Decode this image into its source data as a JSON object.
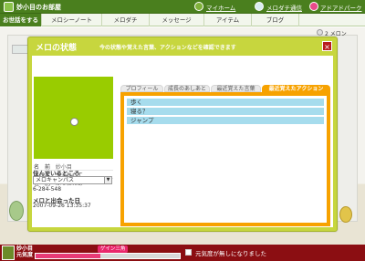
{
  "header": {
    "room_title": "妙小目のお部屋",
    "links": [
      {
        "label": "マイホーム"
      },
      {
        "label": "メロダチ通信"
      },
      {
        "label": "アドアドパーク"
      }
    ]
  },
  "nav": {
    "items": [
      {
        "label": "お世話をする"
      },
      {
        "label": "メロシーノート"
      },
      {
        "label": "メロダチ"
      },
      {
        "label": "メッセージ"
      },
      {
        "label": "アイテム"
      },
      {
        "label": "ブログ"
      }
    ]
  },
  "scene": {
    "meron_count": "2 メロン"
  },
  "modal": {
    "title": "メロの状態",
    "subtitle": "今の状態や覚えた言葉、アクションなどを確認できます",
    "close": "×",
    "profile": {
      "name_key": "名　前",
      "name_val": "妙小目",
      "age_key": "メロ年",
      "age_val": "生まれたて",
      "sex_key": "性　別",
      "sex_val": "ふつにえあ"
    },
    "residence": {
      "title": "住んでいるところ",
      "selected": "メロキャンパス",
      "code": "6-284-548"
    },
    "met": {
      "title": "メロと出会った日",
      "date": "2007-09-26 13:35:37"
    },
    "tabs": [
      {
        "label": "プロフィール"
      },
      {
        "label": "成長のあしあと"
      },
      {
        "label": "最近覚えた言葉"
      },
      {
        "label": "最近覚えたアクション"
      }
    ],
    "actions": [
      {
        "label": "歩く"
      },
      {
        "label": "寝る？"
      },
      {
        "label": "ジャンプ"
      }
    ]
  },
  "footer": {
    "name_line1": "妙小目",
    "name_line2": "元気度",
    "badge": "ゲイン三角",
    "energy_fraction": 0.45,
    "notice": "元気度が無しになりました"
  },
  "colors": {
    "header_green": "#4a7f1e",
    "modal_green": "#c7d63e",
    "tab_orange": "#f7a200",
    "row_blue": "#a6dced",
    "footer_red": "#8b0e12",
    "close_red": "#b81d1d"
  }
}
